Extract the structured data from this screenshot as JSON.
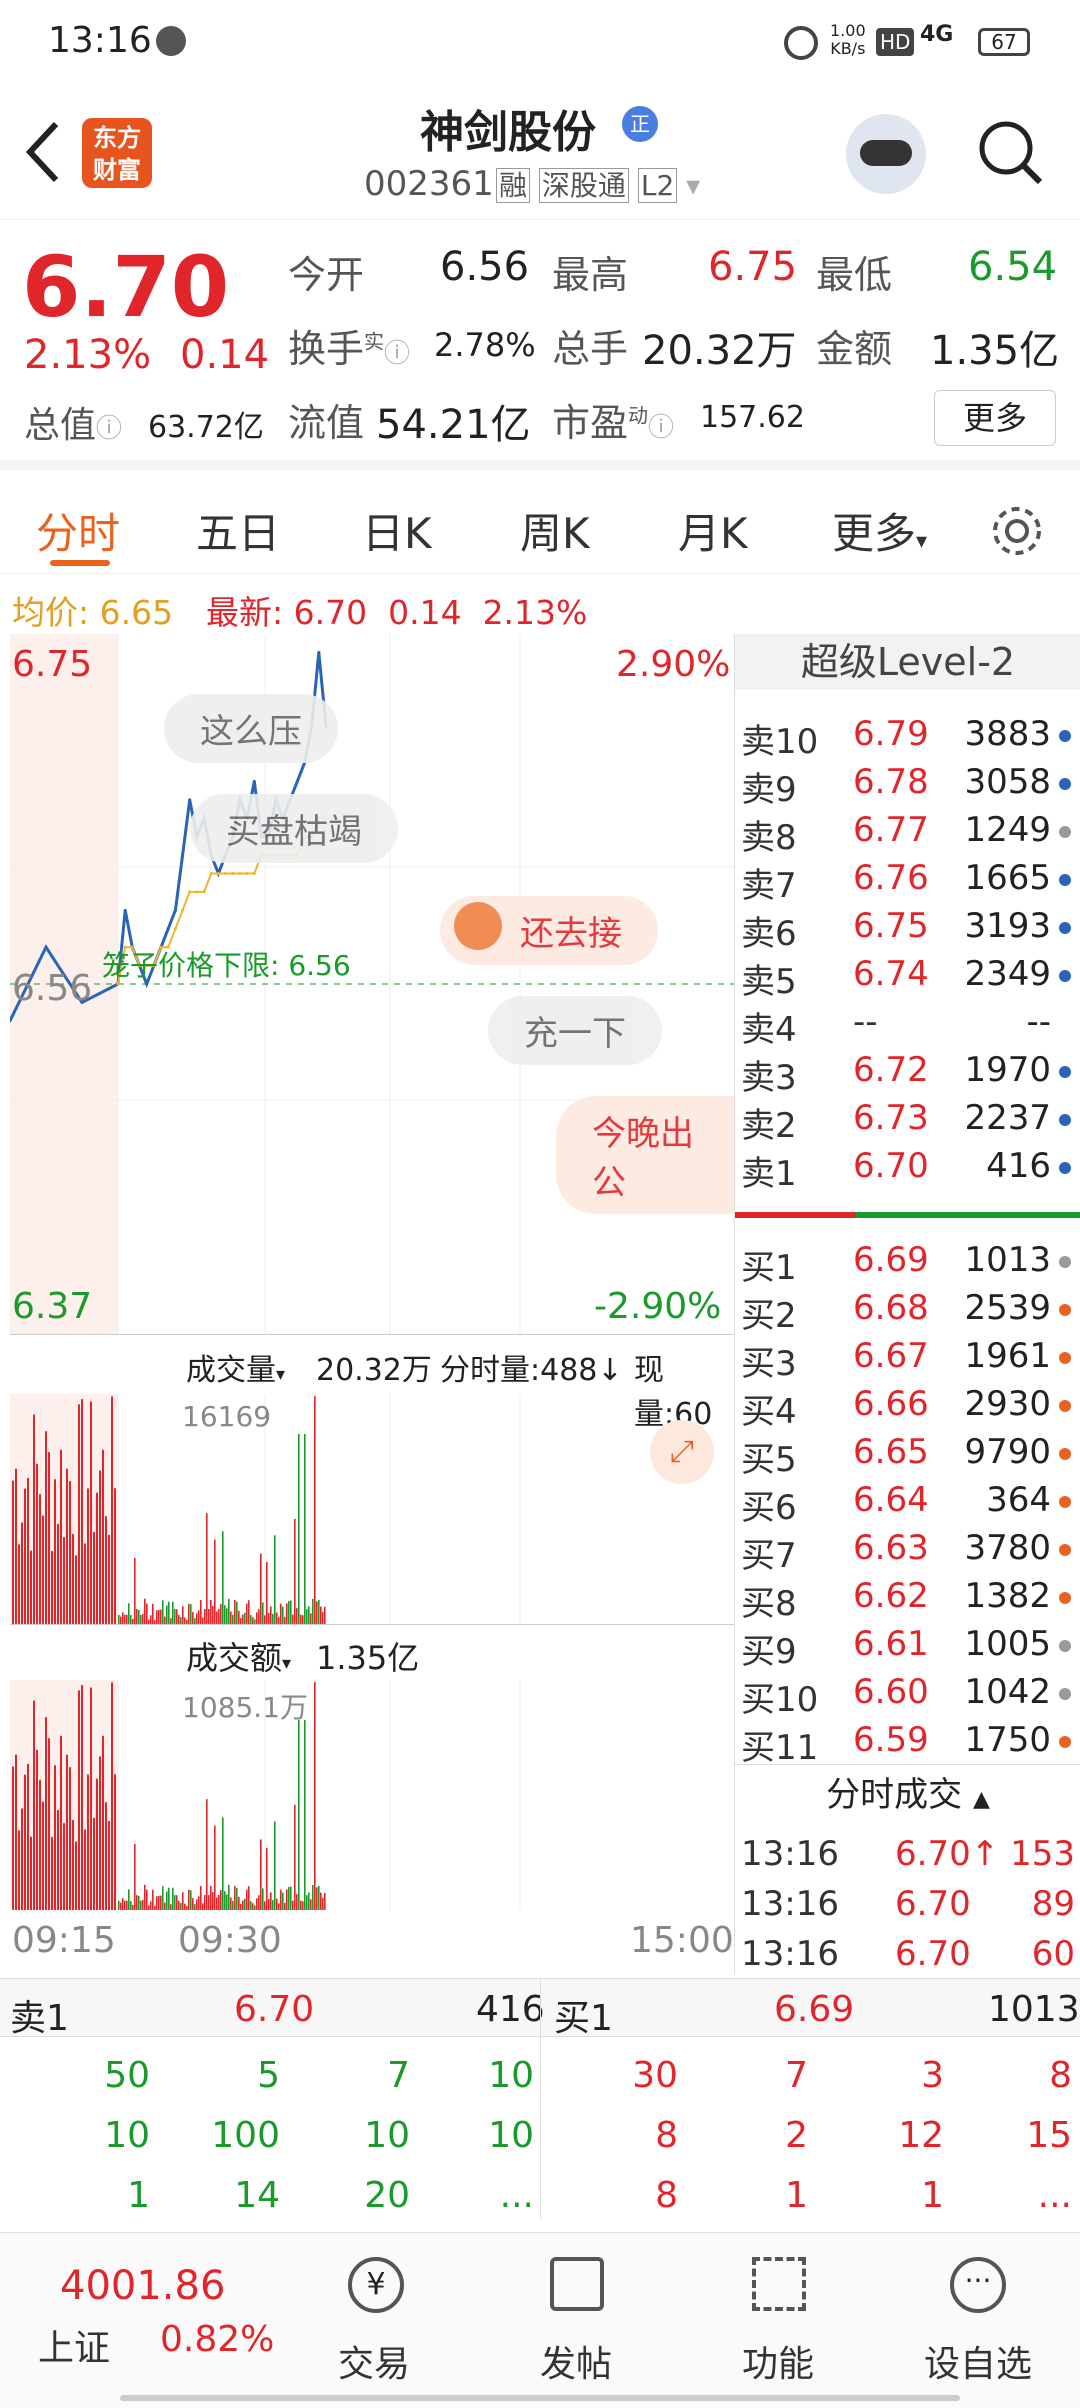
{
  "status": {
    "time": "13:16",
    "net_speed": "1.00",
    "net_unit": "KB/s",
    "hd": "HD",
    "net": "4G",
    "battery": "67"
  },
  "header": {
    "back_label": "<",
    "logo_line1": "东方",
    "logo_line2": "财富",
    "stock_name": "神剑股份",
    "name_badge": "正",
    "code": "002361",
    "tags": [
      "融",
      "深股通",
      "L2"
    ]
  },
  "quote": {
    "price": "6.70",
    "change_pct": "2.13%",
    "change": "0.14",
    "open_label": "今开",
    "open": "6.56",
    "high_label": "最高",
    "high": "6.75",
    "low_label": "最低",
    "low": "6.54",
    "turnover_label": "换手",
    "turnover_sup": "实",
    "turnover": "2.78%",
    "volume_label": "总手",
    "volume": "20.32万",
    "amount_label": "金额",
    "amount": "1.35亿",
    "mktcap_label": "总值",
    "mktcap": "63.72亿",
    "float_label": "流值",
    "float": "54.21亿",
    "pe_label": "市盈",
    "pe_sup": "动",
    "pe": "157.62",
    "more": "更多"
  },
  "tabs": [
    "分时",
    "五日",
    "日K",
    "周K",
    "月K",
    "更多"
  ],
  "avg_bar": {
    "avg_label": "均价:",
    "avg": "6.65",
    "last_label": "最新:",
    "last": "6.70",
    "chg": "0.14",
    "pct": "2.13%"
  },
  "chart": {
    "y_top": "6.75",
    "y_mid": "6.56",
    "y_bot": "6.37",
    "pct_top": "2.90%",
    "pct_bot": "-2.90%",
    "limit_label": "笼子价格下限: 6.56",
    "bubbles": [
      "这么压",
      "买盘枯竭",
      "还去接",
      "充一下",
      "今晚出公"
    ],
    "vol_label": "成交量",
    "vol_total": "20.32万",
    "vol_minute": "分时量:488↓",
    "vol_now": "现量:60",
    "vol_max": "16169",
    "amt_label": "成交额",
    "amt_total": "1.35亿",
    "amt_max": "1085.1万",
    "x_start": "09:15",
    "x_open": "09:30",
    "x_end": "15:00"
  },
  "chart_data": {
    "type": "line",
    "title": "",
    "x": [
      "09:15",
      "09:20",
      "09:25",
      "09:30",
      "09:35",
      "09:40",
      "09:45",
      "09:50",
      "09:55",
      "10:00",
      "10:05",
      "10:10",
      "10:15",
      "10:20",
      "10:25",
      "10:30",
      "10:35",
      "10:40",
      "10:45",
      "10:50",
      "10:55",
      "11:00",
      "11:05",
      "11:10",
      "11:15",
      "11:20",
      "11:25",
      "11:30",
      "13:00",
      "13:05",
      "13:10",
      "13:15",
      "13:16"
    ],
    "series": [
      {
        "values": [
          6.54,
          6.58,
          6.55,
          6.56,
          6.6,
          6.58,
          6.57,
          6.56,
          6.57,
          6.58,
          6.59,
          6.6,
          6.63,
          6.66,
          6.64,
          6.65,
          6.63,
          6.62,
          6.63,
          6.64,
          6.66,
          6.65,
          6.67,
          6.64,
          6.64,
          6.66,
          6.65,
          6.66,
          6.67,
          6.68,
          6.7,
          6.74,
          6.7
        ]
      },
      {
        "values": [
          null,
          null,
          null,
          6.56,
          6.58,
          6.58,
          6.57,
          6.57,
          6.57,
          6.58,
          6.58,
          6.59,
          6.6,
          6.61,
          6.61,
          6.61,
          6.62,
          6.62,
          6.62,
          6.62,
          6.62,
          6.62,
          6.62,
          6.63,
          6.63,
          6.63,
          6.63,
          6.63,
          6.63,
          6.64,
          6.64,
          6.65,
          6.65
        ]
      }
    ],
    "ylim": [
      6.37,
      6.75
    ],
    "xlabel": "",
    "ylabel": ""
  },
  "orderbook": {
    "title": "超级Level-2",
    "sells": [
      [
        "卖10",
        "6.79",
        "3883",
        "blue"
      ],
      [
        "卖9",
        "6.78",
        "3058",
        "blue"
      ],
      [
        "卖8",
        "6.77",
        "1249",
        "gray"
      ],
      [
        "卖7",
        "6.76",
        "1665",
        "blue"
      ],
      [
        "卖6",
        "6.75",
        "3193",
        "blue"
      ],
      [
        "卖5",
        "6.74",
        "2349",
        "blue"
      ],
      [
        "卖4",
        "--",
        "--",
        ""
      ],
      [
        "卖3",
        "6.72",
        "1970",
        "blue"
      ],
      [
        "卖2",
        "6.73",
        "2237",
        "blue"
      ],
      [
        "卖1",
        "6.70",
        "416",
        "blue"
      ]
    ],
    "buys": [
      [
        "买1",
        "6.69",
        "1013",
        "gray"
      ],
      [
        "买2",
        "6.68",
        "2539",
        "orange"
      ],
      [
        "买3",
        "6.67",
        "1961",
        "orange"
      ],
      [
        "买4",
        "6.66",
        "2930",
        "orange"
      ],
      [
        "买5",
        "6.65",
        "9790",
        "orange"
      ],
      [
        "买6",
        "6.64",
        "364",
        "orange"
      ],
      [
        "买7",
        "6.63",
        "3780",
        "orange"
      ],
      [
        "买8",
        "6.62",
        "1382",
        "orange"
      ],
      [
        "买9",
        "6.61",
        "1005",
        "gray"
      ],
      [
        "买10",
        "6.60",
        "1042",
        "gray"
      ],
      [
        "买11",
        "6.59",
        "1750",
        "orange"
      ]
    ],
    "ticks_title": "分时成交",
    "ticks": [
      [
        "13:16",
        "6.70↑",
        "153"
      ],
      [
        "13:16",
        "6.70",
        "89"
      ],
      [
        "13:16",
        "6.70",
        "60"
      ]
    ]
  },
  "bottom_table": {
    "sell_label": "卖1",
    "sell_price": "6.70",
    "sell_qty": "416",
    "buy_label": "买1",
    "buy_price": "6.69",
    "buy_qty": "1013",
    "sell_rows": [
      [
        "50",
        "5",
        "7",
        "10"
      ],
      [
        "10",
        "100",
        "10",
        "10"
      ],
      [
        "1",
        "14",
        "20",
        "..."
      ]
    ],
    "buy_rows": [
      [
        "30",
        "7",
        "3",
        "8"
      ],
      [
        "8",
        "2",
        "12",
        "15"
      ],
      [
        "8",
        "1",
        "1",
        "..."
      ]
    ]
  },
  "nav": {
    "index_value": "4001.86",
    "index_name": "上证",
    "index_pct": "0.82%",
    "items": [
      "交易",
      "发帖",
      "功能",
      "设自选"
    ]
  },
  "colors": {
    "up": "#e0252b",
    "down": "#1a9a2a",
    "accent": "#e8641e",
    "price_line": "#2a64b8",
    "avg_line": "#f2b42c"
  }
}
